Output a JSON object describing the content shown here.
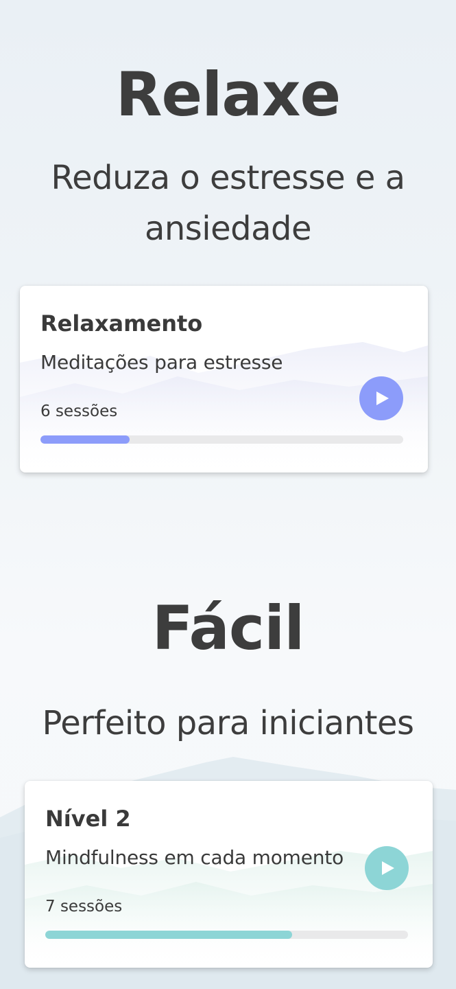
{
  "sections": [
    {
      "title": "Relaxe",
      "subtitle_line1": "Reduza o estresse e a",
      "subtitle_line2": "ansiedade",
      "card": {
        "title": "Relaxamento",
        "subtitle": "Meditações para estresse",
        "sessions": "6 sessões",
        "progress": 0.245,
        "accent_color": "#8c9cfa",
        "play_icon": "play-icon"
      }
    },
    {
      "title": "Fácil",
      "subtitle_line1": "Perfeito para iniciantes",
      "card": {
        "title": "Nível 2",
        "subtitle": "Mindfulness em cada momento",
        "sessions": "7 sessões",
        "progress": 0.68,
        "accent_color": "#8dd5d6",
        "play_icon": "play-icon"
      }
    }
  ]
}
